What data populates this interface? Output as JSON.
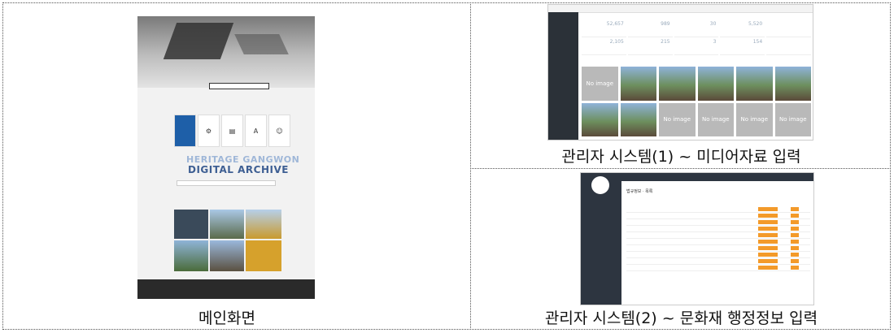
{
  "captions": {
    "main": "메인화면",
    "admin1": "관리자 시스템(1) ~ 미디어자료 입력",
    "admin2": "관리자 시스템(2) ~ 문화재 행정정보 입력"
  },
  "main_screen": {
    "brand_line1": "HERITAGE GANGWON",
    "brand_line2": "DIGITAL ARCHIVE"
  },
  "admin1_screen": {
    "tile_label": "No image",
    "stats": [
      "52,657",
      "989",
      "30",
      "5,520",
      "2,105",
      "215",
      "3",
      "154"
    ]
  },
  "admin2_screen": {
    "page_title": "법규정보 · 목록"
  },
  "colors": {
    "accent_orange": "#f39a2a",
    "brand_blue": "#3e5f93",
    "sidebar_dark": "#2b3138"
  }
}
